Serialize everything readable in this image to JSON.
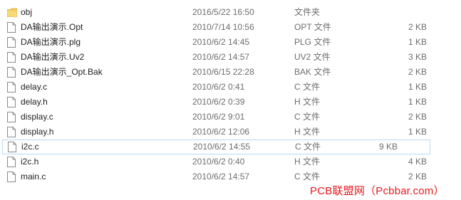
{
  "files": [
    {
      "name": "obj",
      "date": "2016/5/22 16:50",
      "type": "文件夹",
      "size": "",
      "icon": "folder-icon"
    },
    {
      "name": "DA输出演示.Opt",
      "date": "2010/7/14 10:56",
      "type": "OPT 文件",
      "size": "2 KB",
      "icon": "file-icon"
    },
    {
      "name": "DA输出演示.plg",
      "date": "2010/6/2 14:45",
      "type": "PLG 文件",
      "size": "1 KB",
      "icon": "file-icon"
    },
    {
      "name": "DA输出演示.Uv2",
      "date": "2010/6/2 14:57",
      "type": "UV2 文件",
      "size": "3 KB",
      "icon": "file-icon"
    },
    {
      "name": "DA输出演示_Opt.Bak",
      "date": "2010/6/15 22:28",
      "type": "BAK 文件",
      "size": "2 KB",
      "icon": "file-icon"
    },
    {
      "name": "delay.c",
      "date": "2010/6/2 0:41",
      "type": "C 文件",
      "size": "1 KB",
      "icon": "file-icon"
    },
    {
      "name": "delay.h",
      "date": "2010/6/2 0:39",
      "type": "H 文件",
      "size": "1 KB",
      "icon": "file-icon"
    },
    {
      "name": "display.c",
      "date": "2010/6/2 9:01",
      "type": "C 文件",
      "size": "2 KB",
      "icon": "file-icon"
    },
    {
      "name": "display.h",
      "date": "2010/6/2 12:06",
      "type": "H 文件",
      "size": "1 KB",
      "icon": "file-icon"
    },
    {
      "name": "i2c.c",
      "date": "2010/6/2 14:55",
      "type": "C 文件",
      "size": "9 KB",
      "icon": "file-icon",
      "selected": true
    },
    {
      "name": "i2c.h",
      "date": "2010/6/2 0:40",
      "type": "H 文件",
      "size": "4 KB",
      "icon": "file-icon"
    },
    {
      "name": "main.c",
      "date": "2010/6/2 14:57",
      "type": "C 文件",
      "size": "2 KB",
      "icon": "file-icon"
    }
  ],
  "watermark": "PCB联盟网（Pcbbar.com）",
  "colors": {
    "folder": "#f5cb5c",
    "selection_border": "#b9d9f2",
    "watermark": "#e8181e"
  }
}
